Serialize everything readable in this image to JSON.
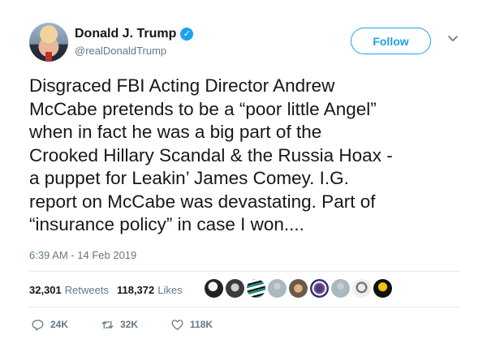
{
  "author": {
    "display_name": "Donald J. Trump",
    "handle": "@realDonaldTrump",
    "verified": true
  },
  "follow_label": "Follow",
  "tweet_text": "Disgraced FBI Acting Director Andrew\nMcCabe pretends to be a “poor little Angel”\nwhen in fact he was a big part of the\nCrooked Hillary Scandal & the Russia Hoax -\na puppet for Leakin’ James Comey. I.G.\nreport on McCabe was devastating. Part of\n“insurance policy” in case I won....",
  "timestamp": "6:39 AM - 14 Feb 2019",
  "stats": {
    "retweets_count": "32,301",
    "retweets_label": "Retweets",
    "likes_count": "118,372",
    "likes_label": "Likes"
  },
  "actions": {
    "reply_count": "24K",
    "retweet_count": "32K",
    "like_count": "118K"
  },
  "colors": {
    "accent": "#1da1f2",
    "muted": "#657786",
    "text": "#14171a",
    "divider": "#e6ecf0"
  }
}
